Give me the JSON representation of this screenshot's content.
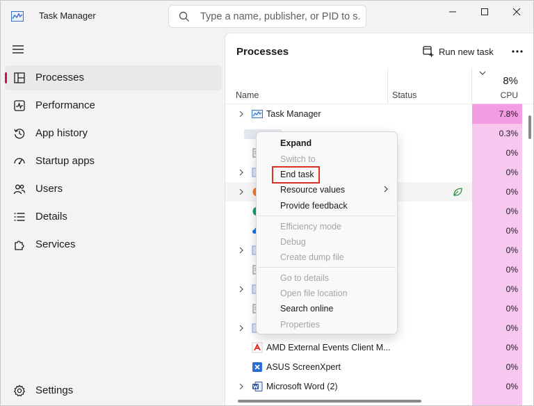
{
  "window": {
    "title": "Task Manager",
    "search_placeholder": "Type a name, publisher, or PID to s..."
  },
  "sidebar": {
    "items": [
      {
        "label": "Processes",
        "active": true
      },
      {
        "label": "Performance"
      },
      {
        "label": "App history"
      },
      {
        "label": "Startup apps"
      },
      {
        "label": "Users"
      },
      {
        "label": "Details"
      },
      {
        "label": "Services"
      }
    ],
    "settings_label": "Settings"
  },
  "main": {
    "title": "Processes",
    "run_new_task": "Run new task",
    "columns": {
      "name": "Name",
      "status": "Status",
      "cpu_total": "8%",
      "cpu": "CPU"
    },
    "rows": [
      {
        "name": "Task Manager",
        "cpu": "7.8%"
      },
      {
        "name": "",
        "cpu": "0.3%"
      },
      {
        "name": "",
        "cpu": "0%"
      },
      {
        "name": "",
        "cpu": "0%"
      },
      {
        "name": "",
        "cpu": "0%"
      },
      {
        "name": "",
        "cpu": "0%"
      },
      {
        "name": "",
        "cpu": "0%"
      },
      {
        "name": "",
        "cpu": "0%"
      },
      {
        "name": "",
        "cpu": "0%"
      },
      {
        "name": "",
        "cpu": "0%"
      },
      {
        "name": "",
        "cpu": "0%"
      },
      {
        "name": "",
        "cpu": "0%"
      },
      {
        "name": "AMD External Events Client M...",
        "cpu": "0%"
      },
      {
        "name": "ASUS ScreenXpert",
        "cpu": "0%"
      },
      {
        "name": "Microsoft Word (2)",
        "cpu": "0%"
      }
    ]
  },
  "context_menu": {
    "items": [
      {
        "label": "Expand",
        "state": "bold"
      },
      {
        "label": "Switch to",
        "state": "disabled"
      },
      {
        "label": "End task",
        "state": "highlighted"
      },
      {
        "label": "Resource values",
        "state": "submenu"
      },
      {
        "label": "Provide feedback",
        "state": "enabled"
      },
      {
        "label": "Efficiency mode",
        "state": "disabled"
      },
      {
        "label": "Debug",
        "state": "disabled"
      },
      {
        "label": "Create dump file",
        "state": "disabled"
      },
      {
        "label": "Go to details",
        "state": "disabled"
      },
      {
        "label": "Open file location",
        "state": "disabled"
      },
      {
        "label": "Search online",
        "state": "enabled"
      },
      {
        "label": "Properties",
        "state": "disabled"
      }
    ]
  },
  "colors": {
    "cpu_heat_low": "#f7c7ef",
    "cpu_heat_high": "#f39be3",
    "active_indicator": "#c2185b",
    "highlight_box": "#d93025"
  }
}
